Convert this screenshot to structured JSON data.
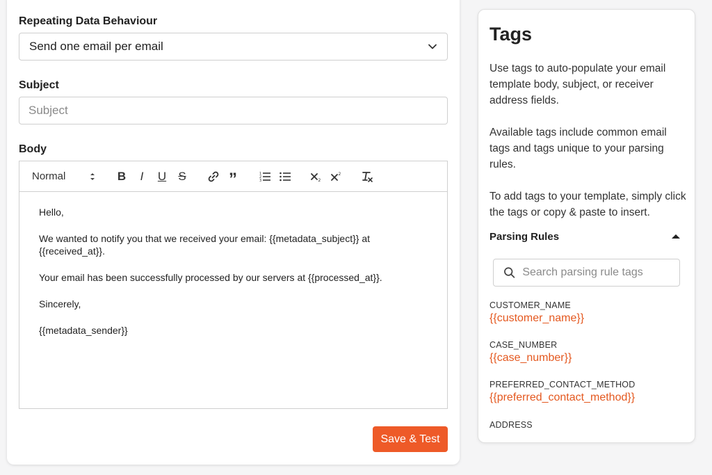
{
  "form": {
    "repeating_label": "Repeating Data Behaviour",
    "repeating_value": "Send one email per email",
    "subject_label": "Subject",
    "subject_placeholder": "Subject",
    "subject_value": "",
    "body_label": "Body",
    "toolbar": {
      "format_select": "Normal",
      "bold": "B",
      "italic": "I",
      "underline": "U",
      "strike": "S",
      "quote": "”"
    },
    "body_lines": [
      "Hello,",
      "We wanted to notify you that we received your email: {{metadata_subject}} at {{received_at}}.",
      "Your email has been successfully processed by our servers at {{processed_at}}.",
      "Sincerely,",
      "{{metadata_sender}}"
    ],
    "save_button": "Save & Test"
  },
  "tags_panel": {
    "title": "Tags",
    "desc_1": "Use tags to auto-populate your email template body, subject, or receiver address fields.",
    "desc_2": "Available tags include common email tags and tags unique to your parsing rules.",
    "desc_3": "To add tags to your template, simply click the tags or copy & paste to insert.",
    "rules_header": "Parsing Rules",
    "search_placeholder": "Search parsing rule tags",
    "tags": [
      {
        "name": "CUSTOMER_NAME",
        "value": "{{customer_name}}"
      },
      {
        "name": "CASE_NUMBER",
        "value": "{{case_number}}"
      },
      {
        "name": "PREFERRED_CONTACT_METHOD",
        "value": "{{preferred_contact_method}}"
      },
      {
        "name": "ADDRESS",
        "value": ""
      }
    ]
  },
  "colors": {
    "accent": "#ee5a28",
    "tag_text": "#e4581f"
  }
}
